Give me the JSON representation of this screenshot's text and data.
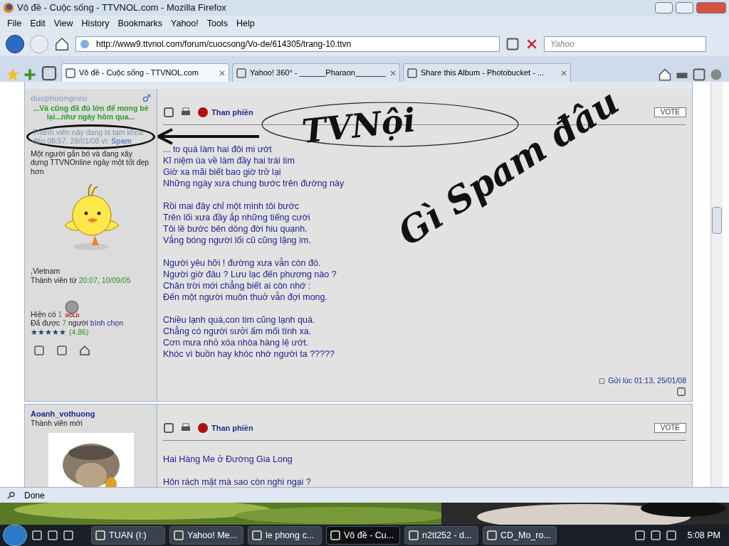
{
  "window": {
    "title": "Vô đề - Cuộc sống - TTVNOL.com - Mozilla Firefox"
  },
  "menu": [
    "File",
    "Edit",
    "View",
    "History",
    "Bookmarks",
    "Yahoo!",
    "Tools",
    "Help"
  ],
  "address": {
    "url": "http://www9.ttvnol.com/forum/cuocsong/Vo-de/614305/trang-10.ttvn"
  },
  "search": {
    "placeholder": "Yahoo"
  },
  "tabs": [
    {
      "label": "Vô đề - Cuộc sống - TTVNOL.com",
      "selected": true
    },
    {
      "label": "Yahoo! 360° - ______Pharaon_______",
      "selected": false
    },
    {
      "label": "Share this Album - Photobucket - ...",
      "selected": false
    }
  ],
  "posts": [
    {
      "username": "ducphuongneu",
      "suspended": true,
      "signature": "...Và cũng đã đủ lớn để mong bé lại...như ngày hôm qua...",
      "suspension": "Thành viên này đang bị tạm khóa đến 08:57, 28/01/08 vì:",
      "suspension_reason": "Spam",
      "bio": "Một người gắn bó và đang xây dựng TTVNOnline ngày một tốt đẹp hơn",
      "location": ",Vietnam",
      "joined_label": "Thành viên từ",
      "joined_date": "20:07, 10/09/05",
      "rank_label": "Hiện có",
      "rank_count": "1",
      "medal": "GOLD",
      "votes": [
        {
          "text": "Đã được",
          "kind": "plain"
        },
        {
          "text": "7",
          "kind": "count"
        },
        {
          "text": "người",
          "kind": "plain"
        },
        {
          "text": "bình chọn",
          "kind": "link"
        }
      ],
      "stars": 5,
      "rating": "(4.86)",
      "complain": "Than phiền",
      "vote": "VOTE",
      "stanzas": [
        [
          "... to quá làm hai đôi mi ướt",
          "Kĩ niệm ùa về làm đầy hai trái tim",
          "Giờ xa mãi biết bao giờ trở lại",
          "Những ngày xưa chung bước trên đường này"
        ],
        [
          "Rồi mai đây chỉ một mình tôi bước",
          "Trên lối xưa đầy ắp những tiếng cười",
          "Tôi lê bước bên dòng đời hiu quạnh.",
          "Vắng bóng người lối cũ cũng lặng im."
        ],
        [
          "Người yêu hỡi ! đường xưa vẫn còn đó.",
          "Người giờ đâu ? Lưu lạc đến phương nào ?",
          "Chân trời mới chẳng biết ai còn nhớ :",
          "Đến một người muôn thuở vẫn đợi mong."
        ],
        [
          "Chiều lạnh quá,con tim cũng lạnh quá.",
          "Chẳng có người sưởi ấm mối tình xa.",
          "Cơn mưa nhỏ xóa nhòa hàng lệ ướt.",
          "Khóc vì buồn hay khóc nhớ người ta ?????"
        ]
      ],
      "posted": "Gửi lúc 01:13, 25/01/08"
    },
    {
      "username": "Aoanh_vothuong",
      "suspended": false,
      "user_title": "Thành viên mới",
      "complain": "Than phiền",
      "vote": "VOTE",
      "stanzas": [
        [
          "Hai Hàng Me ở Đường Gia Long"
        ],
        [
          "Hôn rách mặt mà sao còn nghi ngại ?"
        ]
      ]
    }
  ],
  "annotations": [
    "TVNội",
    "Gì Spam đâu"
  ],
  "status_bar": {
    "text": "Done"
  },
  "taskbar": {
    "items": [
      {
        "label": "TUAN (I:)",
        "selected": false
      },
      {
        "label": "Yahoo! Me...",
        "selected": false
      },
      {
        "label": "le phong c...",
        "selected": false
      },
      {
        "label": "Vô đề - Cu...",
        "selected": true
      },
      {
        "label": "n2tl252 - d...",
        "selected": false
      },
      {
        "label": "CD_Mo_ro...",
        "selected": false
      }
    ],
    "clock": "5:08 PM"
  }
}
